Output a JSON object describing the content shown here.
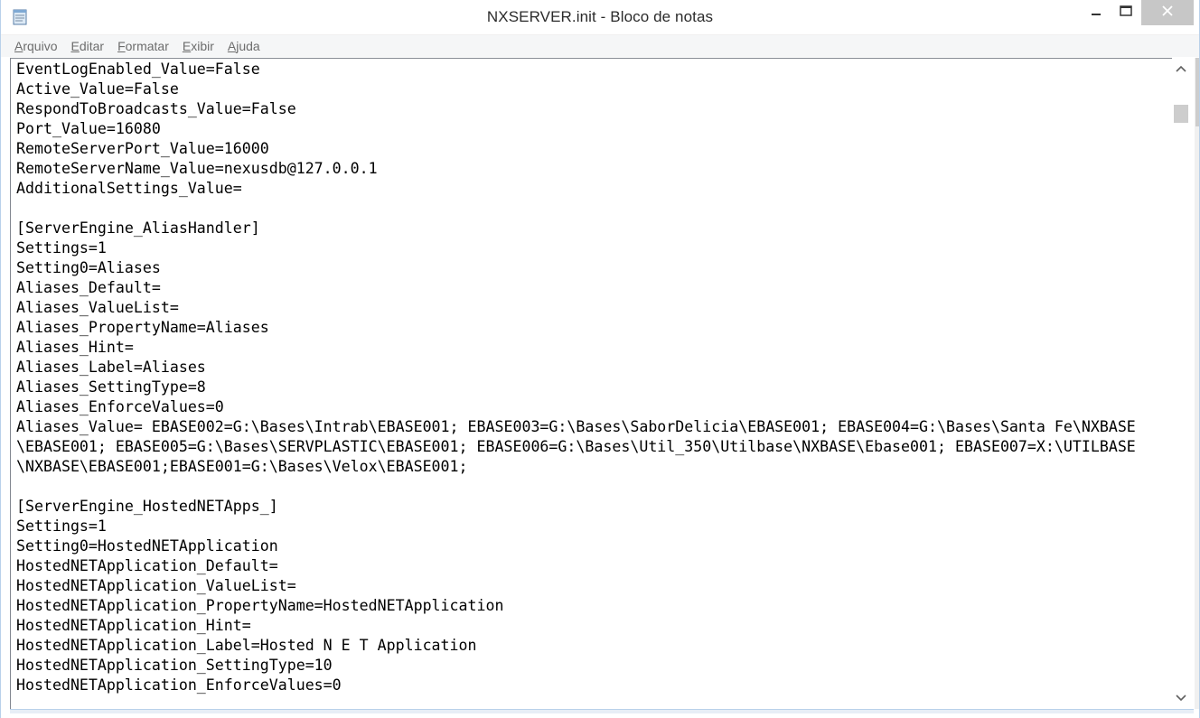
{
  "window": {
    "title": "NXSERVER.init - Bloco de notas"
  },
  "icons": {
    "app": "notepad-icon",
    "minimize": "minimize-icon",
    "maximize": "maximize-icon",
    "close": "close-icon",
    "scroll_up": "chevron-up-icon",
    "scroll_down": "chevron-down-icon"
  },
  "menu": {
    "items": [
      {
        "mnemonic": "A",
        "rest": "rquivo"
      },
      {
        "mnemonic": "E",
        "rest": "ditar"
      },
      {
        "mnemonic": "F",
        "rest": "ormatar"
      },
      {
        "mnemonic": "E",
        "rest": "xibir"
      },
      {
        "mnemonic": "A",
        "rest": "juda"
      }
    ]
  },
  "editor": {
    "content": "EventLogEnabled_Value=False\nActive_Value=False\nRespondToBroadcasts_Value=False\nPort_Value=16080\nRemoteServerPort_Value=16000\nRemoteServerName_Value=nexusdb@127.0.0.1\nAdditionalSettings_Value=\n\n[ServerEngine_AliasHandler]\nSettings=1\nSetting0=Aliases\nAliases_Default=\nAliases_ValueList=\nAliases_PropertyName=Aliases\nAliases_Hint=\nAliases_Label=Aliases\nAliases_SettingType=8\nAliases_EnforceValues=0\nAliases_Value= EBASE002=G:\\Bases\\Intrab\\EBASE001; EBASE003=G:\\Bases\\SaborDelicia\\EBASE001; EBASE004=G:\\Bases\\Santa Fe\\NXBASE\n\\EBASE001; EBASE005=G:\\Bases\\SERVPLASTIC\\EBASE001; EBASE006=G:\\Bases\\Util_350\\Utilbase\\NXBASE\\Ebase001; EBASE007=X:\\UTILBASE\n\\NXBASE\\EBASE001;EBASE001=G:\\Bases\\Velox\\EBASE001;\n\n[ServerEngine_HostedNETApps_]\nSettings=1\nSetting0=HostedNETApplication\nHostedNETApplication_Default=\nHostedNETApplication_ValueList=\nHostedNETApplication_PropertyName=HostedNETApplication\nHostedNETApplication_Hint=\nHostedNETApplication_Label=Hosted N E T Application\nHostedNETApplication_SettingType=10\nHostedNETApplication_EnforceValues=0"
  },
  "colors": {
    "close_button_bg": "#c7c7c7",
    "menubar_bg": "#f5f6f7",
    "menu_text": "#6d6d6d",
    "scroll_thumb": "#cdcdcd"
  }
}
